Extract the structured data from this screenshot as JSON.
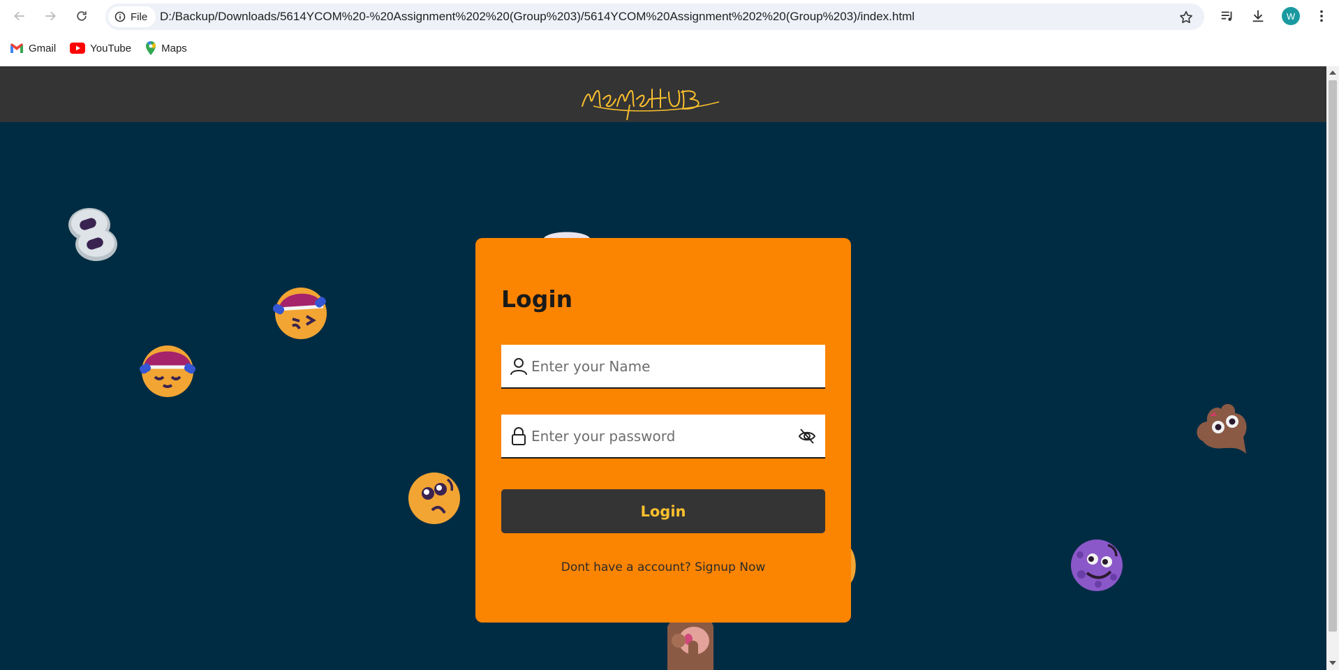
{
  "browser": {
    "site_chip_label": "File",
    "url": "D:/Backup/Downloads/5614YCOM%20-%20Assignment%202%20(Group%203)/5614YCOM%20Assignment%202%20(Group%203)/index.html",
    "profile_initial": "W",
    "bookmarks": [
      {
        "label": "Gmail",
        "icon": "gmail-icon"
      },
      {
        "label": "YouTube",
        "icon": "youtube-icon"
      },
      {
        "label": "Maps",
        "icon": "maps-icon"
      }
    ]
  },
  "header": {
    "logo_text": "MEMEHUB",
    "logo_color": "#fbc02d"
  },
  "login": {
    "title": "Login",
    "name_placeholder": "Enter your Name",
    "password_placeholder": "Enter your password",
    "button_label": "Login",
    "signup_prompt": "Dont have a account?",
    "signup_link": "Signup Now"
  },
  "colors": {
    "page_bg": "#002c43",
    "header_bg": "#343434",
    "card_bg": "#fb8401",
    "button_bg": "#343434",
    "button_text": "#fbc02d"
  },
  "decor": [
    "robot-eyes-emoji",
    "sleepy-beanie-emoji",
    "winking-beanie-emoji",
    "worried-face-emoji",
    "poop-emoji",
    "purple-moon-emoji",
    "monkey-emoji"
  ]
}
